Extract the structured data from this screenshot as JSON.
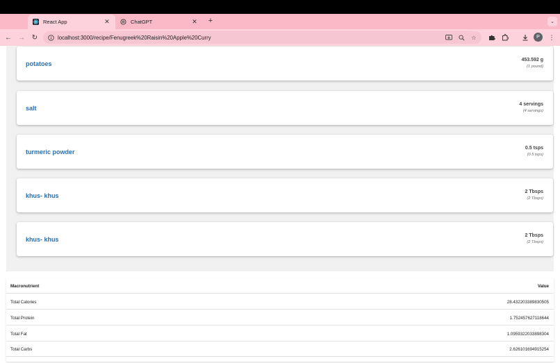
{
  "browser": {
    "tabs": [
      {
        "title": "React App",
        "active": true,
        "icon": "react-icon"
      },
      {
        "title": "ChatGPT",
        "active": false,
        "icon": "openai-icon"
      }
    ],
    "new_tab_label": "+",
    "url": "localhost:3000/recipe/Fenugreek%20Raisin%20Apple%20Curry",
    "profile_initial": "P"
  },
  "ingredients": [
    {
      "name": "potatoes",
      "amount": "453.592 g",
      "original": "(1 pound)"
    },
    {
      "name": "salt",
      "amount": "4 servings",
      "original": "(4 servings)"
    },
    {
      "name": "turmeric powder",
      "amount": "0.5 tsps",
      "original": "(0.5 tsps)"
    },
    {
      "name": "khus- khus",
      "amount": "2 Tbsps",
      "original": "(2 Tbsps)"
    },
    {
      "name": "khus- khus",
      "amount": "2 Tbsps",
      "original": "(2 Tbsps)"
    }
  ],
  "nutrition": {
    "headers": [
      "Macronutrient",
      "Value"
    ],
    "rows": [
      [
        "Total Calories",
        "28.432203389830505"
      ],
      [
        "Total Protein",
        "1.752457627118644"
      ],
      [
        "Total Fat",
        "1.0959322033898304"
      ],
      [
        "Total Carbs",
        "2.626101694915254"
      ]
    ]
  }
}
